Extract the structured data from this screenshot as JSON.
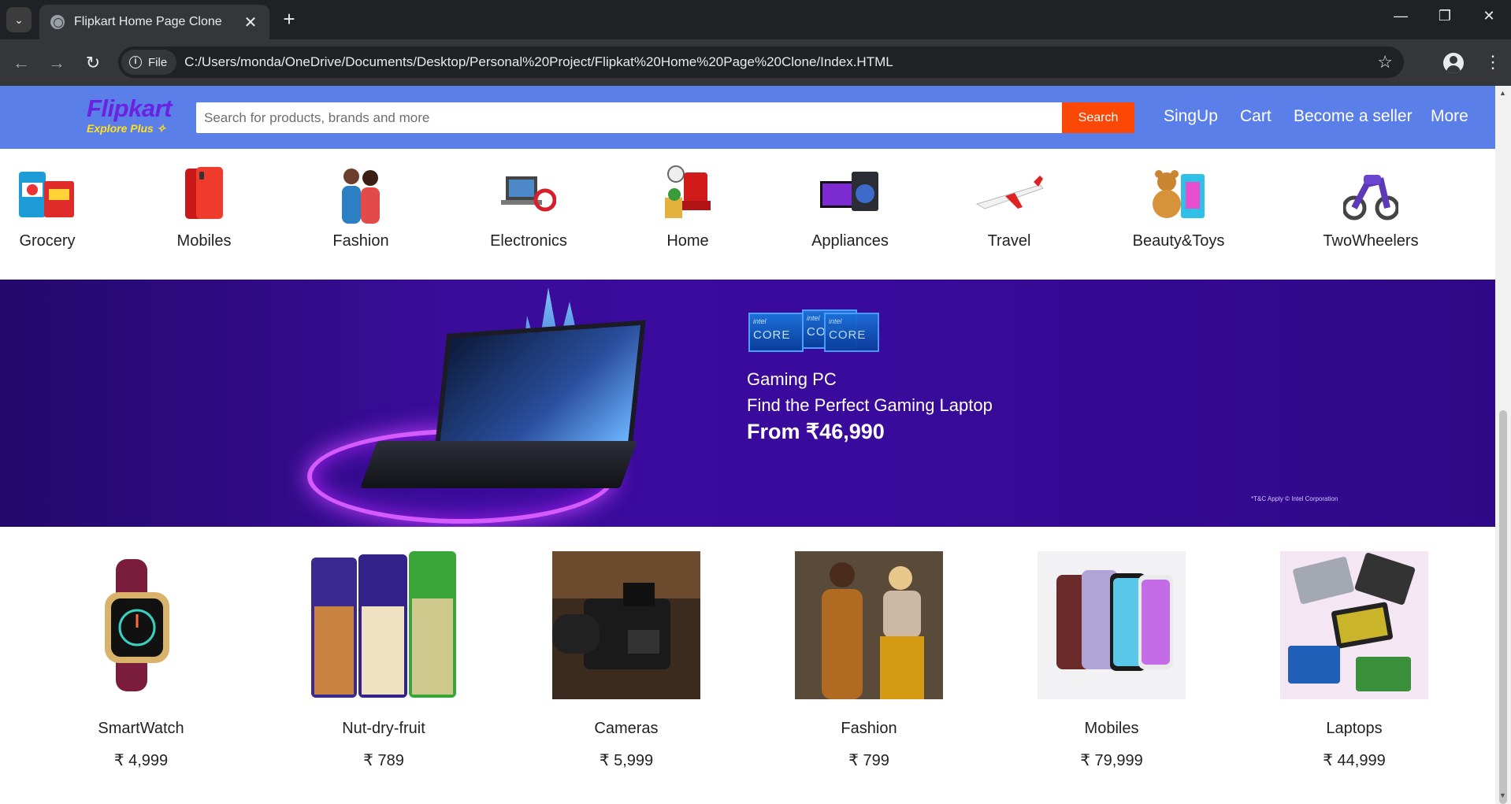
{
  "browser": {
    "tab_title": "Flipkart Home Page Clone",
    "file_chip": "File",
    "url": "C:/Users/monda/OneDrive/Documents/Desktop/Personal%20Project/Flipkat%20Home%20Page%20Clone/Index.HTML",
    "new_tab_glyph": "+",
    "close_glyph": "✕"
  },
  "header": {
    "logo_text": "Flipkart",
    "logo_tagline": "Explore Plus",
    "search_placeholder": "Search for products, brands and more",
    "search_button": "Search",
    "nav": {
      "signup": "SingUp",
      "cart": "Cart",
      "seller": "Become a seller",
      "more": "More"
    },
    "colors": {
      "bar": "#5b7fe8",
      "search_button": "#fb4807",
      "logo": "#6b21e0"
    }
  },
  "categories": [
    {
      "label": "Grocery",
      "icon": "grocery-icon"
    },
    {
      "label": "Mobiles",
      "icon": "mobile-icon"
    },
    {
      "label": "Fashion",
      "icon": "fashion-icon"
    },
    {
      "label": "Electronics",
      "icon": "laptop-icon"
    },
    {
      "label": "Home",
      "icon": "home-icon"
    },
    {
      "label": "Appliances",
      "icon": "appliance-icon"
    },
    {
      "label": "Travel",
      "icon": "airplane-icon"
    },
    {
      "label": "Beauty&Toys",
      "icon": "toy-icon"
    },
    {
      "label": "TwoWheelers",
      "icon": "scooter-icon"
    }
  ],
  "banner": {
    "line1": "Gaming PC",
    "line2": "Find the Perfect Gaming Laptop",
    "line3": "From ₹46,990",
    "fine_print": "*T&C Apply  © Intel Corporation",
    "chip_brand": "intel",
    "chip_label": "CORE"
  },
  "products": [
    {
      "name": "SmartWatch",
      "price": "₹ 4,999",
      "image": "smartwatch-image"
    },
    {
      "name": "Nut-dry-fruit",
      "price": "₹ 789",
      "image": "dry-fruit-image"
    },
    {
      "name": "Cameras",
      "price": "₹ 5,999",
      "image": "camera-image"
    },
    {
      "name": "Fashion",
      "price": "₹ 799",
      "image": "fashion-image"
    },
    {
      "name": "Mobiles",
      "price": "₹ 79,999",
      "image": "mobiles-image"
    },
    {
      "name": "Laptops",
      "price": "₹ 44,999",
      "image": "laptops-image"
    }
  ]
}
